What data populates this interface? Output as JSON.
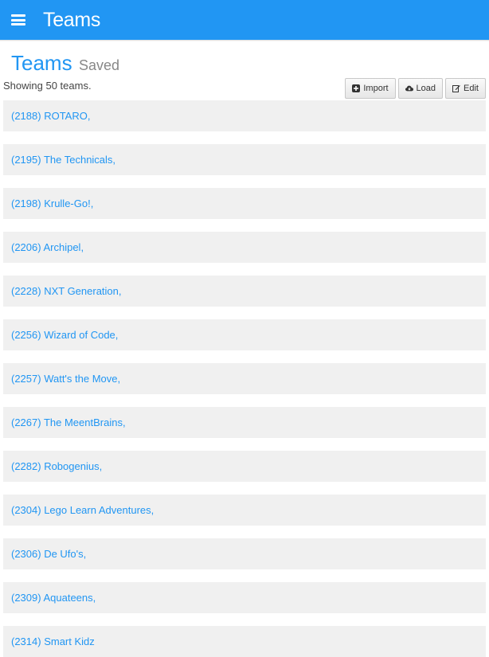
{
  "header": {
    "title": "Teams",
    "menu_icon": "hamburger-menu-icon"
  },
  "page": {
    "title": "Teams",
    "subtitle": "Saved"
  },
  "status": {
    "count_text": "Showing 50 teams."
  },
  "toolbar": {
    "import_label": "Import",
    "load_label": "Load",
    "edit_label": "Edit"
  },
  "teams": [
    "(2188) ROTARO,",
    "(2195) The Technicals,",
    "(2198) Krulle-Go!,",
    "(2206) Archipel,",
    "(2228) NXT Generation,",
    "(2256) Wizard of Code,",
    "(2257) Watt's the Move,",
    "(2267) The MeentBrains,",
    "(2282) Robogenius,",
    "(2304) Lego Learn Adventures,",
    "(2306) De Ufo's,",
    "(2309) Aquateens,",
    "(2314) Smart Kidz"
  ],
  "colors": {
    "accent": "#2196f3",
    "item_bg": "#f0f0f0"
  }
}
